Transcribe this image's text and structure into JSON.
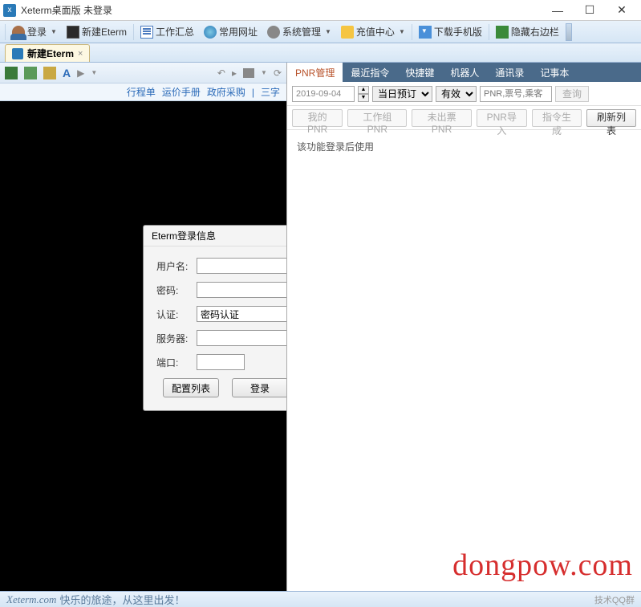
{
  "window": {
    "title": "Xeterm桌面版 未登录"
  },
  "mainToolbar": {
    "login": "登录",
    "newEterm": "新建Eterm",
    "workSummary": "工作汇总",
    "commonUrls": "常用网址",
    "sysManage": "系统管理",
    "recharge": "充值中心",
    "downloadMobile": "下载手机版",
    "hideRightbar": "隐藏右边栏"
  },
  "tab": {
    "label": "新建Eterm",
    "close": "×"
  },
  "leftToolbar": {
    "aLabel": "A"
  },
  "leftLinks": {
    "itinerary": "行程单",
    "fareManual": "运价手册",
    "govPurchase": "政府采购",
    "sep": "|",
    "threeChar": "三字"
  },
  "loginDialog": {
    "title": "Eterm登录信息",
    "username": "用户名:",
    "password": "密码:",
    "auth": "认证:",
    "authValue": "密码认证",
    "server": "服务器:",
    "port": "端口:",
    "configList": "配置列表",
    "loginBtn": "登录"
  },
  "rightTabs": [
    "PNR管理",
    "最近指令",
    "快捷键",
    "机器人",
    "通讯录",
    "记事本"
  ],
  "filter": {
    "date": "2019-09-04",
    "booking": "当日预订",
    "status": "有效",
    "searchPlaceholder": "PNR,票号,乘客",
    "query": "查询"
  },
  "actions": {
    "myPnr": "我的PNR",
    "groupPnr": "工作组PNR",
    "unissued": "未出票PNR",
    "pnrImport": "PNR导入",
    "genCmd": "指令生成",
    "refresh": "刷新列表"
  },
  "rightBody": {
    "message": "该功能登录后使用"
  },
  "statusbar": {
    "domain": "Xeterm.com",
    "slogan": "快乐的旅途，从这里出发！",
    "tech": "技术QQ群"
  },
  "watermark": "dongpow.com"
}
